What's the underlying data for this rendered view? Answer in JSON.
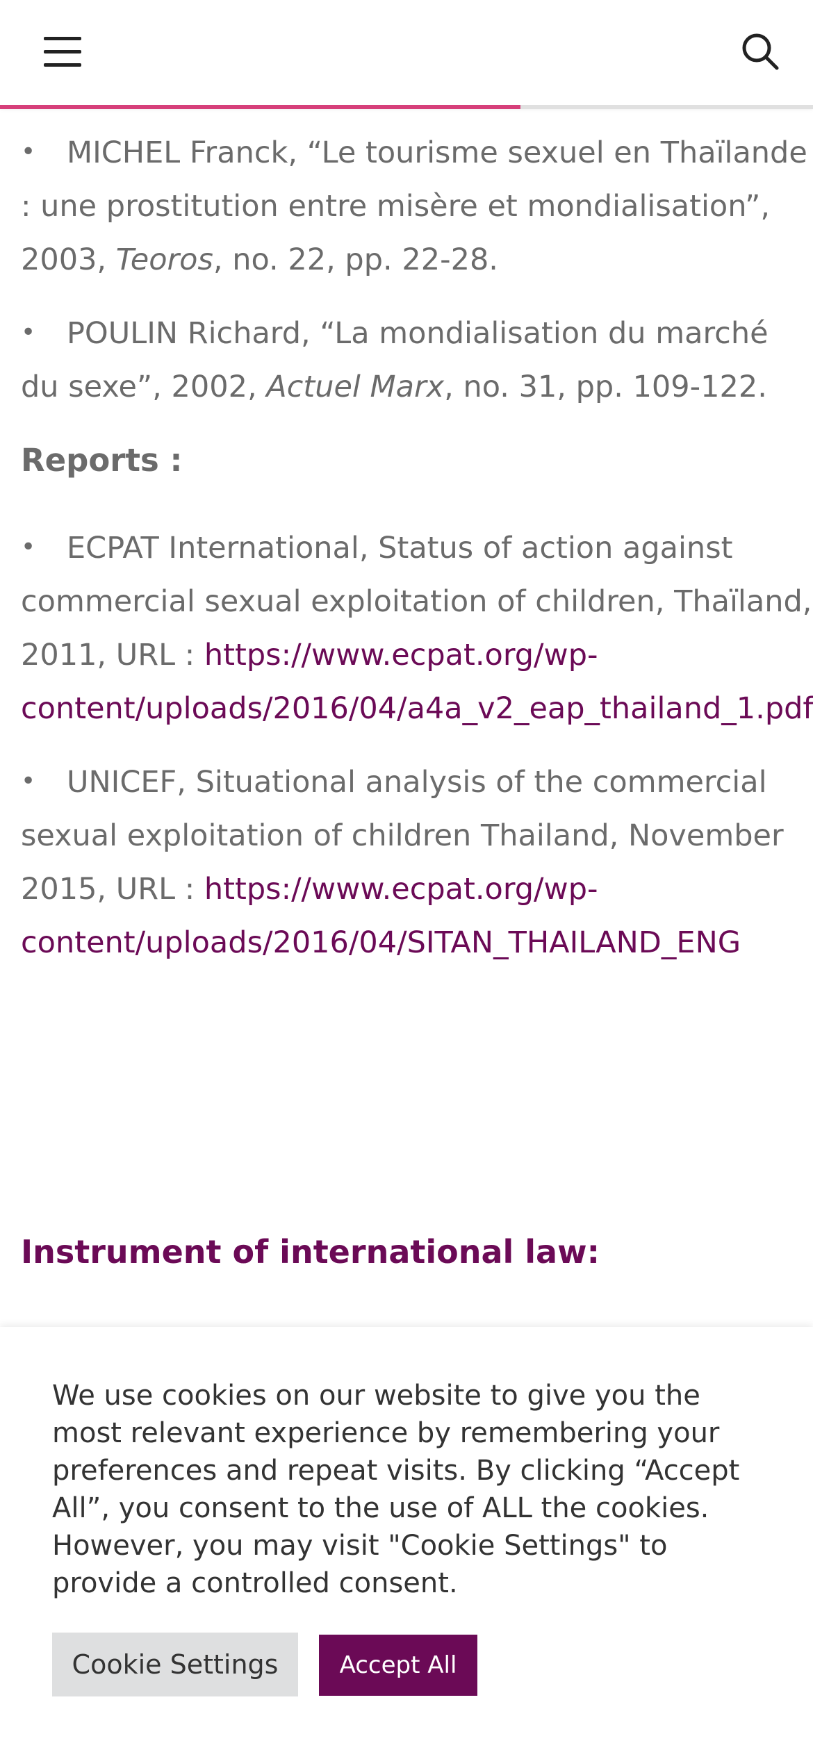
{
  "header": {
    "menu_icon": "hamburger-menu-icon",
    "search_icon": "search-icon",
    "reading_progress": 0.64,
    "progress_color": "#d63f7a"
  },
  "references": [
    {
      "parts": [
        {
          "text": "MICHEL Franck, “Le tourisme sexuel en Thaïlande : une prostitution entre misère et mondialisation”, 2003, "
        },
        {
          "text": "Teoros",
          "italic": true
        },
        {
          "text": ", no. 22, pp. 22-28."
        }
      ]
    },
    {
      "parts": [
        {
          "text": "POULIN Richard, “La mondialisation du marché du sexe”, 2002, "
        },
        {
          "text": "Actuel Marx",
          "italic": true
        },
        {
          "text": ", no. 31, pp. 109-122."
        }
      ]
    }
  ],
  "reports_heading": "Reports :",
  "reports": [
    {
      "text": "ECPAT International, Status of action against commercial sexual exploitation of children, Thaïland, 2011, URL : ",
      "link_line1": "https://www.ecpat.org/wp-",
      "link_line2": "content/uploads/2016/04/a4a_v2_eap_thailand_1.pdf"
    },
    {
      "text": "UNICEF, Situational analysis of the commercial sexual exploitation of children Thailand, November 2015, URL : ",
      "link_line1": "https://www.ecpat.org/wp-",
      "link_line2": "content/uploads/2016/04/SITAN_THAILAND_ENG"
    }
  ],
  "instrument_heading": "Instrument of international law:",
  "cookie": {
    "message": "We use cookies on our website to give you the most relevant experience by remembering your preferences and repeat visits. By clicking “Accept All”, you consent to the use of ALL the cookies. However, you may visit \"Cookie Settings\" to provide a controlled consent.",
    "settings_label": "Cookie Settings",
    "accept_label": "Accept All",
    "accent_color": "#6b0a56"
  },
  "colors": {
    "link": "#6b0a56",
    "body_text": "#6b6b6b"
  }
}
